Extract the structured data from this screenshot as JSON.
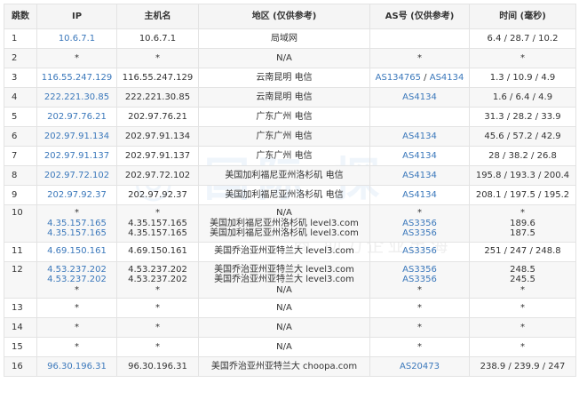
{
  "headers": [
    "跳数",
    "IP",
    "主机名",
    "地区 (仅供参考)",
    "AS号 (仅供参考)",
    "时间 (毫秒)"
  ],
  "watermark": {
    "subtitle": "商 助力企业出海"
  },
  "colors": {
    "link": "#3b78bb",
    "alt_row": "#f7f7f7"
  },
  "rows": [
    {
      "hop": "1",
      "ip": [
        "10.6.7.1"
      ],
      "host": [
        "10.6.7.1"
      ],
      "region": [
        "局域网"
      ],
      "as": [
        ""
      ],
      "time": [
        "6.4 / 28.7 / 10.2"
      ]
    },
    {
      "hop": "2",
      "ip": [
        "*"
      ],
      "host": [
        "*"
      ],
      "region": [
        "N/A"
      ],
      "as": [
        "*"
      ],
      "time": [
        "*"
      ]
    },
    {
      "hop": "3",
      "ip": [
        "116.55.247.129"
      ],
      "host": [
        "116.55.247.129"
      ],
      "region": [
        "云南昆明 电信"
      ],
      "as": [
        "AS134765 / AS4134"
      ],
      "time": [
        "1.3 / 10.9 / 4.9"
      ]
    },
    {
      "hop": "4",
      "ip": [
        "222.221.30.85"
      ],
      "host": [
        "222.221.30.85"
      ],
      "region": [
        "云南昆明 电信"
      ],
      "as": [
        "AS4134"
      ],
      "time": [
        "1.6 / 6.4 / 4.9"
      ]
    },
    {
      "hop": "5",
      "ip": [
        "202.97.76.21"
      ],
      "host": [
        "202.97.76.21"
      ],
      "region": [
        "广东广州 电信"
      ],
      "as": [
        ""
      ],
      "time": [
        "31.3 / 28.2 / 33.9"
      ]
    },
    {
      "hop": "6",
      "ip": [
        "202.97.91.134"
      ],
      "host": [
        "202.97.91.134"
      ],
      "region": [
        "广东广州 电信"
      ],
      "as": [
        "AS4134"
      ],
      "time": [
        "45.6 / 57.2 / 42.9"
      ]
    },
    {
      "hop": "7",
      "ip": [
        "202.97.91.137"
      ],
      "host": [
        "202.97.91.137"
      ],
      "region": [
        "广东广州 电信"
      ],
      "as": [
        "AS4134"
      ],
      "time": [
        "28 / 38.2 / 26.8"
      ]
    },
    {
      "hop": "8",
      "ip": [
        "202.97.72.102"
      ],
      "host": [
        "202.97.72.102"
      ],
      "region": [
        "美国加利福尼亚州洛杉矶 电信"
      ],
      "as": [
        "AS4134"
      ],
      "time": [
        "195.8 / 193.3 / 200.4"
      ]
    },
    {
      "hop": "9",
      "ip": [
        "202.97.92.37"
      ],
      "host": [
        "202.97.92.37"
      ],
      "region": [
        "美国加利福尼亚州洛杉矶 电信"
      ],
      "as": [
        "AS4134"
      ],
      "time": [
        "208.1 / 197.5 / 195.2"
      ]
    },
    {
      "hop": "10",
      "ip": [
        "*",
        "4.35.157.165",
        "4.35.157.165"
      ],
      "host": [
        "*",
        "4.35.157.165",
        "4.35.157.165"
      ],
      "region": [
        "N/A",
        "美国加利福尼亚州洛杉矶 level3.com",
        "美国加利福尼亚州洛杉矶 level3.com"
      ],
      "as": [
        "*",
        "AS3356",
        "AS3356"
      ],
      "time": [
        "*",
        "189.6",
        "187.5"
      ]
    },
    {
      "hop": "11",
      "ip": [
        "4.69.150.161"
      ],
      "host": [
        "4.69.150.161"
      ],
      "region": [
        "美国乔治亚州亚特兰大 level3.com"
      ],
      "as": [
        "AS3356"
      ],
      "time": [
        "251 / 247 / 248.8"
      ]
    },
    {
      "hop": "12",
      "ip": [
        "4.53.237.202",
        "4.53.237.202",
        "*"
      ],
      "host": [
        "4.53.237.202",
        "4.53.237.202",
        "*"
      ],
      "region": [
        "美国乔治亚州亚特兰大 level3.com",
        "美国乔治亚州亚特兰大 level3.com",
        "N/A"
      ],
      "as": [
        "AS3356",
        "AS3356",
        "*"
      ],
      "time": [
        "248.5",
        "245.5",
        "*"
      ]
    },
    {
      "hop": "13",
      "ip": [
        "*"
      ],
      "host": [
        "*"
      ],
      "region": [
        "N/A"
      ],
      "as": [
        "*"
      ],
      "time": [
        "*"
      ]
    },
    {
      "hop": "14",
      "ip": [
        "*"
      ],
      "host": [
        "*"
      ],
      "region": [
        "N/A"
      ],
      "as": [
        "*"
      ],
      "time": [
        "*"
      ]
    },
    {
      "hop": "15",
      "ip": [
        "*"
      ],
      "host": [
        "*"
      ],
      "region": [
        "N/A"
      ],
      "as": [
        "*"
      ],
      "time": [
        "*"
      ]
    },
    {
      "hop": "16",
      "ip": [
        "96.30.196.31"
      ],
      "host": [
        "96.30.196.31"
      ],
      "region": [
        "美国乔治亚州亚特兰大 choopa.com"
      ],
      "as": [
        "AS20473"
      ],
      "time": [
        "238.9 / 239.9 / 247"
      ]
    }
  ]
}
